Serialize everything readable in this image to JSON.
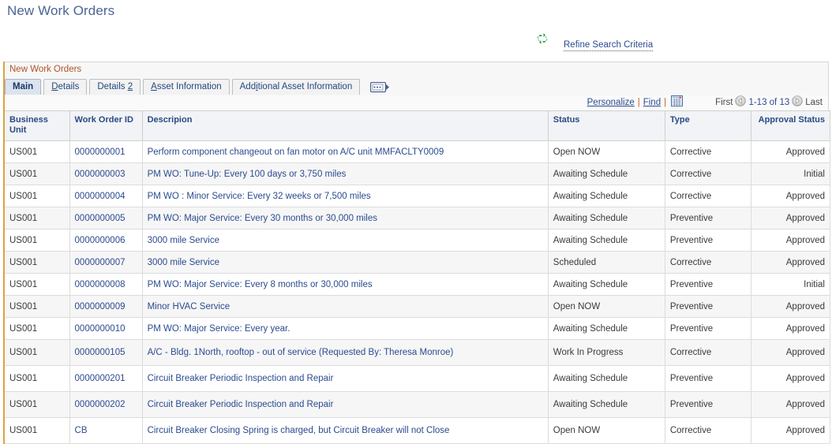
{
  "page": {
    "title": "New Work Orders"
  },
  "header": {
    "refresh_icon": "refresh-icon",
    "refine_link": "Refine Search Criteria"
  },
  "grid": {
    "caption": "New Work Orders",
    "tabs": [
      {
        "label": "Main",
        "accel": "",
        "active": true
      },
      {
        "label": "Details",
        "accel": "D",
        "active": false
      },
      {
        "label": "Details 2",
        "accel": "2",
        "active": false
      },
      {
        "label": "Asset Information",
        "accel": "A",
        "active": false
      },
      {
        "label": "Additional Asset Information",
        "accel": "i",
        "active": false
      }
    ],
    "tab_expand_icon": "show-next-tab-icon",
    "toolbar": {
      "personalize": "Personalize",
      "separator": "|",
      "find": "Find",
      "download_icon": "download-to-spreadsheet-icon",
      "first": "First",
      "prev_icon": "previous-page-icon",
      "range": "1-13 of 13",
      "next_icon": "next-page-icon",
      "last": "Last"
    },
    "columns": [
      "Business Unit",
      "Work Order ID",
      "Descripion",
      "Status",
      "Type",
      "Approval Status"
    ],
    "rows": [
      {
        "business_unit": "US001",
        "work_order_id": "0000000001",
        "description": "Perform component changeout on fan motor on A/C unit MMFACLTY0009",
        "status": "Open NOW",
        "type": "Corrective",
        "approval_status": "Approved"
      },
      {
        "business_unit": "US001",
        "work_order_id": "0000000003",
        "description": "PM WO: Tune-Up: Every 100 days or 3,750 miles",
        "status": "Awaiting Schedule",
        "type": "Corrective",
        "approval_status": "Initial"
      },
      {
        "business_unit": "US001",
        "work_order_id": "0000000004",
        "description": "PM WO : Minor Service: Every 32 weeks or 7,500 miles",
        "status": "Awaiting Schedule",
        "type": "Corrective",
        "approval_status": "Approved"
      },
      {
        "business_unit": "US001",
        "work_order_id": "0000000005",
        "description": "PM WO: Major Service: Every 30 months or 30,000 miles",
        "status": "Awaiting Schedule",
        "type": "Preventive",
        "approval_status": "Approved"
      },
      {
        "business_unit": "US001",
        "work_order_id": "0000000006",
        "description": "3000 mile Service",
        "status": "Awaiting Schedule",
        "type": "Preventive",
        "approval_status": "Approved"
      },
      {
        "business_unit": "US001",
        "work_order_id": "0000000007",
        "description": "3000 mile Service",
        "status": "Scheduled",
        "type": "Corrective",
        "approval_status": "Approved"
      },
      {
        "business_unit": "US001",
        "work_order_id": "0000000008",
        "description": "PM WO: Major Service: Every 8 months or 30,000 miles",
        "status": "Awaiting Schedule",
        "type": "Preventive",
        "approval_status": "Initial"
      },
      {
        "business_unit": "US001",
        "work_order_id": "0000000009",
        "description": "Minor HVAC Service",
        "status": "Open NOW",
        "type": "Preventive",
        "approval_status": "Approved"
      },
      {
        "business_unit": "US001",
        "work_order_id": "0000000010",
        "description": "PM WO: Major Service: Every year.",
        "status": "Awaiting Schedule",
        "type": "Preventive",
        "approval_status": "Approved"
      },
      {
        "business_unit": "US001",
        "work_order_id": "0000000105",
        "description": "A/C - Bldg. 1North, rooftop - out of service (Requested By: Theresa Monroe)",
        "status": "Work In Progress",
        "type": "Corrective",
        "approval_status": "Approved"
      },
      {
        "business_unit": "US001",
        "work_order_id": "0000000201",
        "description": "Circuit Breaker Periodic Inspection and Repair",
        "status": "Awaiting Schedule",
        "type": "Preventive",
        "approval_status": "Approved"
      },
      {
        "business_unit": "US001",
        "work_order_id": "0000000202",
        "description": "Circuit Breaker Periodic Inspection and Repair",
        "status": "Awaiting Schedule",
        "type": "Preventive",
        "approval_status": "Approved"
      },
      {
        "business_unit": "US001",
        "work_order_id": "CB",
        "description": "Circuit Breaker Closing Spring is charged, but Circuit Breaker will not Close",
        "status": "Open NOW",
        "type": "Corrective",
        "approval_status": "Approved"
      }
    ]
  },
  "colors": {
    "title": "#4a6593",
    "link": "#2b4b8f",
    "caption": "#b0522a",
    "panel_accent": "#d9a441",
    "header_bg": "#f1f3f6",
    "header_text": "#2a4a84",
    "stripe": "#f6f6f6",
    "refresh_green": "#2f9e44"
  }
}
